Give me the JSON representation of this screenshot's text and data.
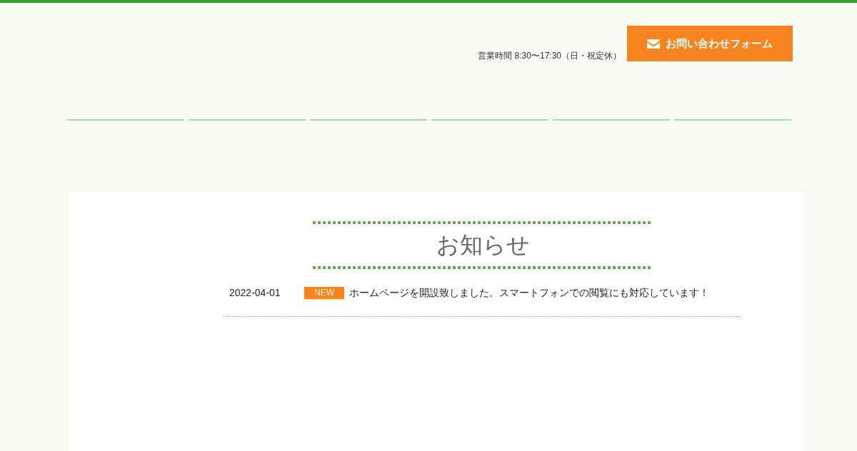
{
  "header": {
    "business_hours": "営業時間 8:30〜17:30（日・祝定休）",
    "contact_button": "お問い合わせフォーム"
  },
  "news": {
    "title": "お知らせ",
    "items": [
      {
        "date": "2022-04-01",
        "badge": "NEW",
        "text": "ホームページを開設致しました。スマートフォンでの閲覧にも対応しています！"
      }
    ]
  }
}
